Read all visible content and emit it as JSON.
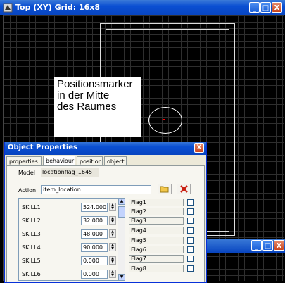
{
  "window": {
    "title": "Top (XY) Grid: 16x8",
    "minimize": "_",
    "maximize": "□",
    "close": "X"
  },
  "annotation": {
    "line1": "Positionsmarker",
    "line2": "in der Mitte",
    "line3": "des Raumes"
  },
  "dialog": {
    "title": "Object Properties",
    "close": "X",
    "tabs": [
      "properties",
      "behaviour",
      "position",
      "object"
    ],
    "active_tab": "behaviour",
    "model_label": "Model",
    "model_value": "locationflag_1645",
    "action_label": "Action",
    "action_value": "item_location",
    "skills": [
      {
        "label": "SKILL1",
        "value": "524.000"
      },
      {
        "label": "SKILL2",
        "value": "32.000"
      },
      {
        "label": "SKILL3",
        "value": "48.000"
      },
      {
        "label": "SKILL4",
        "value": "90.000"
      },
      {
        "label": "SKILL5",
        "value": "0.000"
      },
      {
        "label": "SKILL6",
        "value": "0.000"
      }
    ],
    "flags": [
      "Flag1",
      "Flag2",
      "Flag3",
      "Flag4",
      "Flag5",
      "Flag6",
      "Flag7",
      "Flag8"
    ]
  },
  "colors": {
    "titlebar": "#0a4fd2",
    "marker": "#ff0000",
    "grid": "#2e2e2e"
  }
}
